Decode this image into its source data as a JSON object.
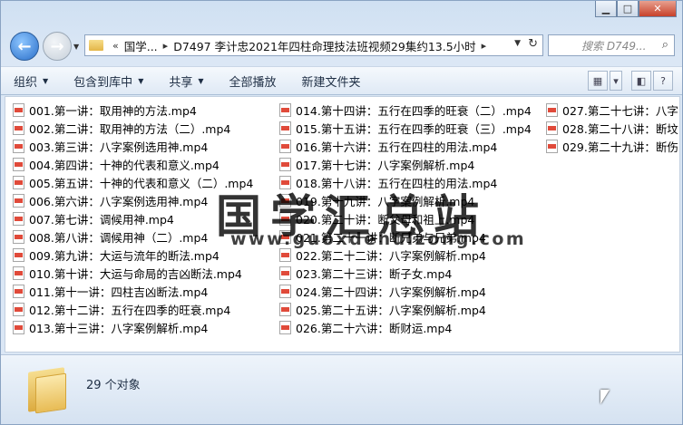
{
  "address": {
    "crumbs": [
      "«",
      "国学...",
      "▸",
      "D7497 李计忠2021年四柱命理技法班视频29集约13.5小时",
      "▸"
    ],
    "search_placeholder": "搜索 D749..."
  },
  "toolbar": {
    "organize": "组织",
    "include": "包含到库中",
    "share": "共享",
    "play_all": "全部播放",
    "new_folder": "新建文件夹"
  },
  "files": {
    "col1": [
      "001.第一讲：取用神的方法.mp4",
      "002.第二讲：取用神的方法（二）.mp4",
      "003.第三讲：八字案例选用神.mp4",
      "004.第四讲：十神的代表和意义.mp4",
      "005.第五讲：十神的代表和意义（二）.mp4",
      "006.第六讲：八字案例选用神.mp4",
      "007.第七讲：调候用神.mp4",
      "008.第八讲：调候用神（二）.mp4",
      "009.第九讲：大运与流年的断法.mp4",
      "010.第十讲：大运与命局的吉凶断法.mp4",
      "011.第十一讲：四柱吉凶断法.mp4",
      "012.第十二讲：五行在四季的旺衰.mp4",
      "013.第十三讲：八字案例解析.mp4"
    ],
    "col2": [
      "014.第十四讲：五行在四季的旺衰（二）.mp4",
      "015.第十五讲：五行在四季的旺衰（三）.mp4",
      "016.第十六讲：五行在四柱的用法.mp4",
      "017.第十七讲：八字案例解析.mp4",
      "018.第十八讲：五行在四柱的用法.mp4",
      "019.第十九讲：八字案例解析.mp4",
      "020.第二十讲：断父母和祖上.mp4",
      "021.第二十一讲：断兄弟与兄弟.mp4",
      "022.第二十二讲：八字案例解析.mp4",
      "023.第二十三讲：断子女.mp4",
      "024.第二十四讲：八字案例解析.mp4",
      "025.第二十五讲：八字案例解析.mp4",
      "026.第二十六讲：断财运.mp4"
    ],
    "col3": [
      "027.第二十七讲：八字",
      "028.第二十八讲：断坟",
      "029.第二十九讲：断伤"
    ]
  },
  "watermark": {
    "title": "国学汇总站",
    "url": "www.guoxdehuizong.com"
  },
  "status": {
    "count": "29 个对象"
  }
}
